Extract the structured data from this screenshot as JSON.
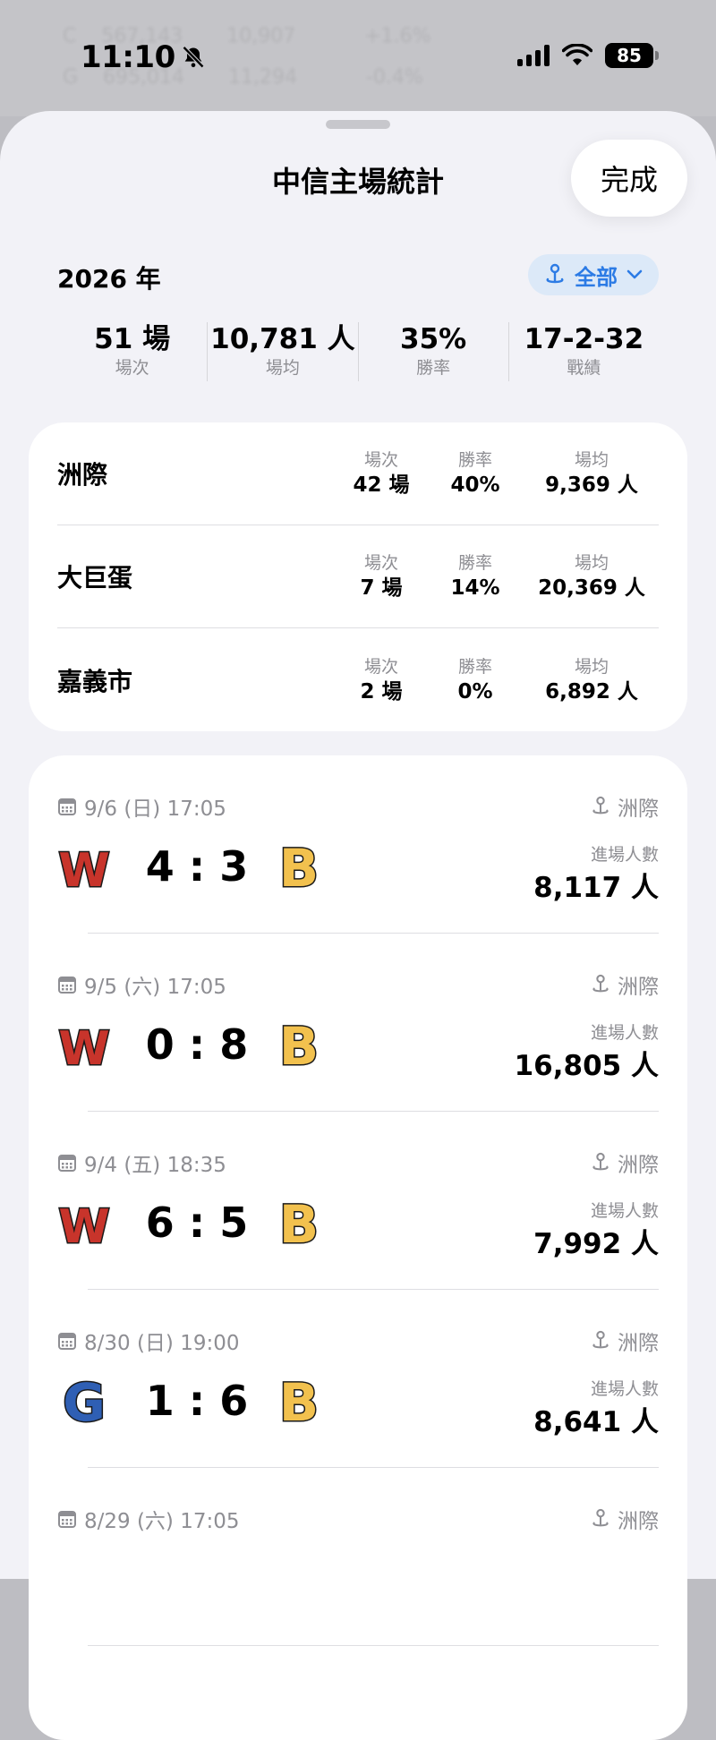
{
  "status": {
    "time": "11:10",
    "battery": "85",
    "background_rows": [
      [
        "C",
        "567,143",
        "10,907",
        "+1.6%"
      ],
      [
        "G",
        "695,014",
        "11,294",
        "-0.4%"
      ]
    ]
  },
  "sheet": {
    "title": "中信主場統計",
    "done_label": "完成"
  },
  "year_label": "2026 年",
  "filter": {
    "label": "全部"
  },
  "summary": [
    {
      "value": "51 場",
      "label": "場次"
    },
    {
      "value": "10,781 人",
      "label": "場均"
    },
    {
      "value": "35%",
      "label": "勝率"
    },
    {
      "value": "17-2-32",
      "label": "戰績"
    }
  ],
  "venue_labels": {
    "games": "場次",
    "winrate": "勝率",
    "avg": "場均"
  },
  "venues": [
    {
      "name": "洲際",
      "games": "42 場",
      "winrate": "40%",
      "avg": "9,369 人"
    },
    {
      "name": "大巨蛋",
      "games": "7 場",
      "winrate": "14%",
      "avg": "20,369 人"
    },
    {
      "name": "嘉義市",
      "games": "2 場",
      "winrate": "0%",
      "avg": "6,892 人"
    }
  ],
  "attendance_label": "進場人數",
  "colors": {
    "accent": "#2c7be5",
    "team_w": "#c8342b",
    "team_b": "#f2c14e",
    "team_g": "#2f5fb4"
  },
  "games": [
    {
      "date": "9/6 (日) 17:05",
      "venue": "洲際",
      "away": "W",
      "home": "B",
      "score": "4 : 3",
      "attendance": "8,117 人"
    },
    {
      "date": "9/5 (六) 17:05",
      "venue": "洲際",
      "away": "W",
      "home": "B",
      "score": "0 : 8",
      "attendance": "16,805 人"
    },
    {
      "date": "9/4 (五) 18:35",
      "venue": "洲際",
      "away": "W",
      "home": "B",
      "score": "6 : 5",
      "attendance": "7,992 人"
    },
    {
      "date": "8/30 (日) 19:00",
      "venue": "洲際",
      "away": "G",
      "home": "B",
      "score": "1 : 6",
      "attendance": "8,641 人"
    },
    {
      "date": "8/29 (六) 17:05",
      "venue": "洲際",
      "away": "",
      "home": "",
      "score": "",
      "attendance": ""
    }
  ]
}
